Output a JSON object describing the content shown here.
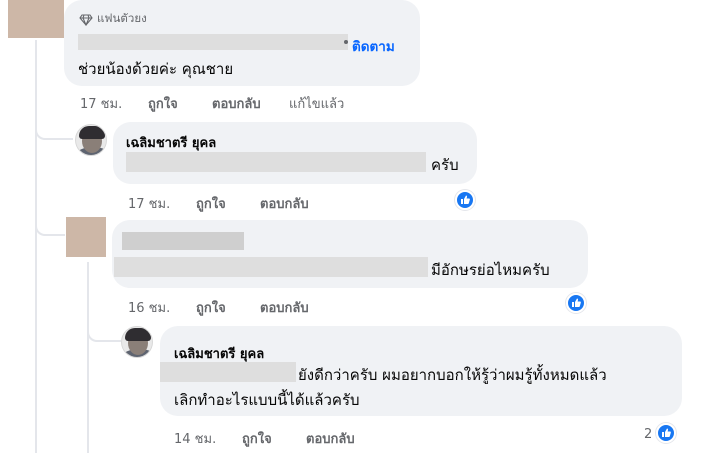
{
  "comment1": {
    "badge_icon": "diamond-icon",
    "badge": "แฟนตัวยง",
    "follow": "ติดตาม",
    "text": "ช่วยน้องด้วยค่ะ คุณชาย",
    "time": "17 ชม.",
    "like": "ถูกใจ",
    "reply": "ตอบกลับ",
    "edited": "แก้ไขแล้ว"
  },
  "reply1": {
    "name": "เฉลิมชาตรี ยุคล",
    "text": "ครับ",
    "time": "17 ชม.",
    "like": "ถูกใจ",
    "reply": "ตอบกลับ",
    "reaction_icon": "thumbs-up-icon"
  },
  "comment2": {
    "text": "มีอักษรย่อไหมครับ",
    "time": "16 ชม.",
    "like": "ถูกใจ",
    "reply": "ตอบกลับ",
    "reaction_icon": "thumbs-up-icon"
  },
  "reply2": {
    "name": "เฉลิมชาตรี ยุคล",
    "text_line1": "ยังดีกว่าครับ ผมอยากบอกให้รู้ว่าผมรู้ทั้งหมดแล้ว",
    "text_line2": "เลิกทำอะไรแบบนี้ได้แล้วครับ",
    "time": "14 ชม.",
    "like": "ถูกใจ",
    "reply": "ตอบกลับ",
    "reaction_count": "2",
    "reaction_icon": "thumbs-up-icon"
  },
  "colors": {
    "bubble": "#f0f2f5",
    "link": "#0866ff",
    "meta": "#65676b",
    "like": "#1877f2"
  }
}
